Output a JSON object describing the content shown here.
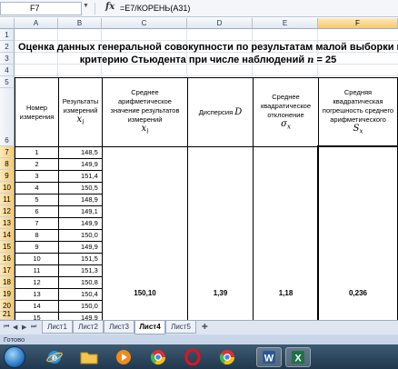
{
  "formula_bar": {
    "cell_ref": "F7",
    "fx": "fx",
    "formula": "=E7/КОРЕНЬ(A31)"
  },
  "columns": [
    "A",
    "B",
    "C",
    "D",
    "E",
    "F"
  ],
  "selected_column": "F",
  "rows": [
    "1",
    "2",
    "3",
    "4",
    "5",
    "6",
    "7",
    "8",
    "9",
    "10",
    "11",
    "12",
    "13",
    "14",
    "15",
    "16",
    "17",
    "18",
    "19",
    "20",
    "21"
  ],
  "selected_rows": [
    "7",
    "8",
    "9",
    "10",
    "11",
    "12",
    "13",
    "14",
    "15",
    "16",
    "17",
    "18",
    "19",
    "20",
    "21"
  ],
  "title": {
    "line1": "Оценка данных генеральной совокупности по результатам малой выборки по",
    "line2_a": "критерию Стьюдента при числе наблюдений",
    "line2_n": "n",
    "line2_b": " = 25"
  },
  "headers": {
    "a": "Номер измерения",
    "b": "Результаты измерений",
    "b_sym": "x",
    "b_sub": "i",
    "c": "Среднее арифметическое значение результатов измерений",
    "c_sym": "x",
    "c_sub": "i",
    "d": "Дисперсия",
    "d_sym": "D",
    "e": "Среднее квадратическое отклонение",
    "e_sym": "σ",
    "e_sub": "x",
    "f": "Средняя квадратическая погрешность среднего арифметического",
    "f_sym": "S",
    "f_sub": "x"
  },
  "measurements": [
    {
      "n": "1",
      "x": "148,5"
    },
    {
      "n": "2",
      "x": "149,9"
    },
    {
      "n": "3",
      "x": "151,4"
    },
    {
      "n": "4",
      "x": "150,5"
    },
    {
      "n": "5",
      "x": "148,9"
    },
    {
      "n": "6",
      "x": "149,1"
    },
    {
      "n": "7",
      "x": "149,9"
    },
    {
      "n": "8",
      "x": "150,0"
    },
    {
      "n": "9",
      "x": "149,9"
    },
    {
      "n": "10",
      "x": "151,5"
    },
    {
      "n": "11",
      "x": "151,3"
    },
    {
      "n": "12",
      "x": "150,8"
    },
    {
      "n": "13",
      "x": "150,4"
    },
    {
      "n": "14",
      "x": "150,0"
    },
    {
      "n": "15",
      "x": "149,9"
    }
  ],
  "results": {
    "mean": "150,10",
    "variance": "1,39",
    "std_dev": "1,18",
    "std_err": "0,236"
  },
  "sheets": [
    "Лист1",
    "Лист2",
    "Лист3",
    "Лист4",
    "Лист5"
  ],
  "active_sheet": "Лист4",
  "status_text": "Готово",
  "taskbar_apps": [
    "ie-icon",
    "folder-icon",
    "media-player-icon",
    "chrome-icon",
    "opera-icon",
    "chrome-icon-2",
    "word-icon",
    "excel-icon"
  ]
}
